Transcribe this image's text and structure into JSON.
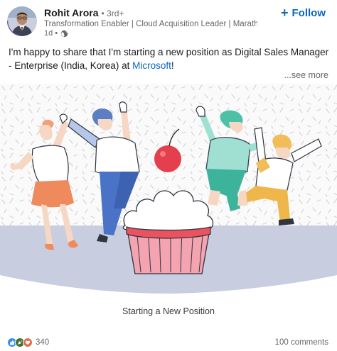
{
  "post": {
    "author": {
      "name": "Rohit Arora",
      "degree": "• 3rd+",
      "headline": "Transformation Enabler | Cloud Acquisition Leader | Maratho...",
      "time": "1d •"
    },
    "follow_label": "Follow",
    "text_before": "I'm happy to share that I'm starting a new position as Digital Sales Manager - Enterprise (India, Korea) at ",
    "company": "Microsoft",
    "text_after": "!",
    "see_more": "...see more",
    "image_caption": "Starting a New Position",
    "reaction_count": "340",
    "comments": "100 comments"
  },
  "icons": {
    "globe": "globe-icon",
    "plus": "plus-icon",
    "like": "like-icon",
    "celebrate": "celebrate-icon",
    "love": "love-icon"
  },
  "colors": {
    "accent": "#0a66c2",
    "like": "#378fe9",
    "celebrate": "#44712e",
    "love": "#df704d"
  }
}
